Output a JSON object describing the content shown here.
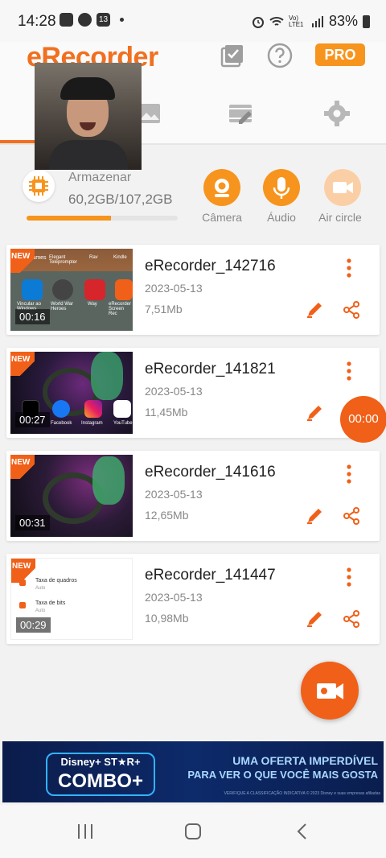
{
  "status_bar": {
    "time": "14:28",
    "badge_count": "13",
    "battery": "83%",
    "network": "Vo) LTE1"
  },
  "header": {
    "brand": "eRecorder",
    "pro": "PRO"
  },
  "storage": {
    "label": "Armazenar",
    "value": "60,2GB/107,2GB",
    "used_fraction": 0.56
  },
  "modes": [
    {
      "label": "Câmera",
      "icon": "camera-icon"
    },
    {
      "label": "Áudio",
      "icon": "microphone-icon"
    },
    {
      "label": "Air circle",
      "icon": "video-camera-icon"
    }
  ],
  "recordings": [
    {
      "title": "eRecorder_142716",
      "date": "2023-05-13",
      "size": "7,51Mb",
      "duration": "00:16",
      "badge": "NEW",
      "thumb_labels": [
        "Games",
        "Elegant Teleprompter",
        "Rav",
        "Kindle",
        "Vincular ao Windows",
        "World War Heroes",
        "Way",
        "eRecorder Screen Rec"
      ]
    },
    {
      "title": "eRecorder_141821",
      "date": "2023-05-13",
      "size": "11,45Mb",
      "duration": "00:27",
      "badge": "NEW",
      "thumb_labels": [
        "Facebook",
        "Instagram",
        "YouTube"
      ]
    },
    {
      "title": "eRecorder_141616",
      "date": "2023-05-13",
      "size": "12,65Mb",
      "duration": "00:31",
      "badge": "NEW",
      "thumb_labels": []
    },
    {
      "title": "eRecorder_141447",
      "date": "2023-05-13",
      "size": "10,98Mb",
      "duration": "00:29",
      "badge": "NEW",
      "thumb_labels": [
        "Taxa de quadros",
        "Auto",
        "Taxa de bits",
        "Auto"
      ]
    }
  ],
  "timer": "00:00",
  "ad": {
    "logo_top": "Disney+ ST★R+",
    "logo_main": "COMBO+",
    "line1": "UMA OFERTA IMPERDÍVEL",
    "line2": "PARA VER O QUE VOCÊ MAIS GOSTA",
    "fine_print": "VERIFIQUE A CLASSIFICAÇÃO INDICATIVA © 2023 Disney e suas empresas afiliadas"
  },
  "colors": {
    "accent": "#f06018",
    "accent_light": "#f7941d"
  }
}
